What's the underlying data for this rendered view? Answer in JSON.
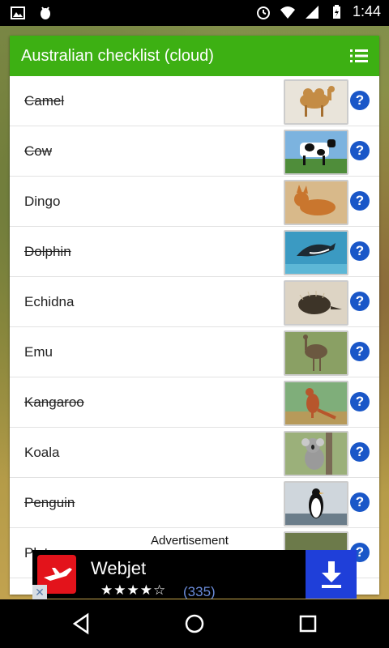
{
  "status": {
    "time": "1:44",
    "icons": [
      "image-icon",
      "android-debug-icon",
      "alarm-icon",
      "wifi-icon",
      "signal-icon",
      "battery-icon"
    ]
  },
  "app": {
    "title": "Australian checklist (cloud)",
    "accent": "#3db013",
    "help_color": "#1a57c8"
  },
  "animals": [
    {
      "name": "Camel",
      "checked": true
    },
    {
      "name": "Cow",
      "checked": true
    },
    {
      "name": "Dingo",
      "checked": false
    },
    {
      "name": "Dolphin",
      "checked": true
    },
    {
      "name": "Echidna",
      "checked": false
    },
    {
      "name": "Emu",
      "checked": false
    },
    {
      "name": "Kangaroo",
      "checked": true
    },
    {
      "name": "Koala",
      "checked": false
    },
    {
      "name": "Penguin",
      "checked": true
    },
    {
      "name": "Platypus",
      "checked": false
    }
  ],
  "ad": {
    "label": "Advertisement",
    "name": "Webjet",
    "stars": "★★★★☆",
    "count": "(335)",
    "close": "✕"
  }
}
